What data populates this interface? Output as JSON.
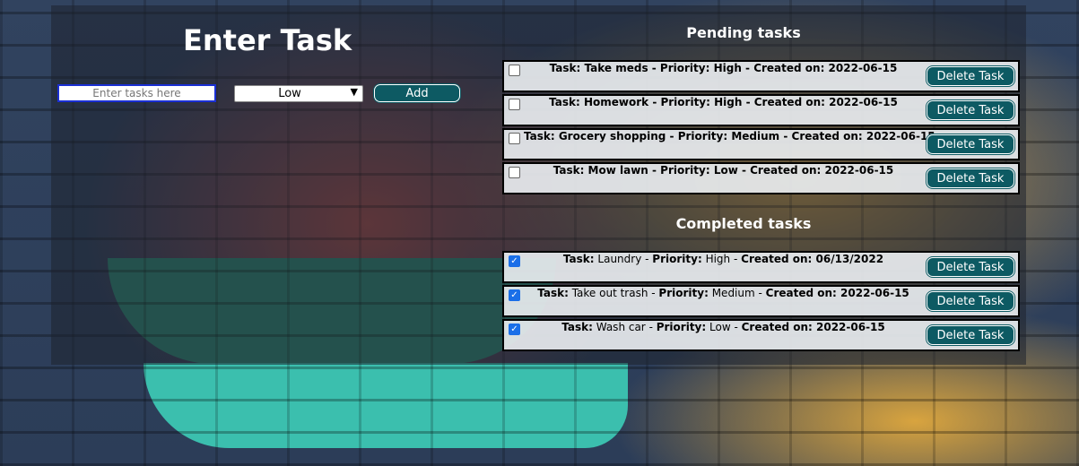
{
  "header": {
    "title": "Enter Task"
  },
  "form": {
    "input_placeholder": "Enter tasks here",
    "priority_selected": "Low",
    "add_label": "Add"
  },
  "pending": {
    "title": "Pending tasks",
    "tasks": [
      {
        "text": "Task: Take meds - Priority: High - Created on: 2022-06-15",
        "checked": false,
        "delete_label": "Delete Task"
      },
      {
        "text": "Task: Homework - Priority: High - Created on: 2022-06-15",
        "checked": false,
        "delete_label": "Delete Task"
      },
      {
        "text": "Task: Grocery shopping - Priority: Medium - Created on: 2022-06-15",
        "checked": false,
        "delete_label": "Delete Task"
      },
      {
        "text": "Task: Mow lawn - Priority: Low - Created on: 2022-06-15",
        "checked": false,
        "delete_label": "Delete Task"
      }
    ]
  },
  "completed": {
    "title": "Completed tasks",
    "tasks": [
      {
        "task_label": "Task:",
        "task_name": "Laundry",
        "priority_label": "Priority:",
        "priority": "High",
        "created_label": "Created on: 06/13/2022",
        "checked": true,
        "delete_label": "Delete Task"
      },
      {
        "task_label": "Task:",
        "task_name": "Take out trash",
        "priority_label": "Priority:",
        "priority": "Medium",
        "created_label": "Created on: 2022-06-15",
        "checked": true,
        "delete_label": "Delete Task"
      },
      {
        "task_label": "Task:",
        "task_name": "Wash car",
        "priority_label": "Priority:",
        "priority": "Low",
        "created_label": "Created on: 2022-06-15",
        "checked": true,
        "delete_label": "Delete Task"
      }
    ]
  },
  "colors": {
    "button_bg": "#0d5a63",
    "input_border": "#1a2fd4",
    "checkbox_checked": "#1a6fe8"
  }
}
